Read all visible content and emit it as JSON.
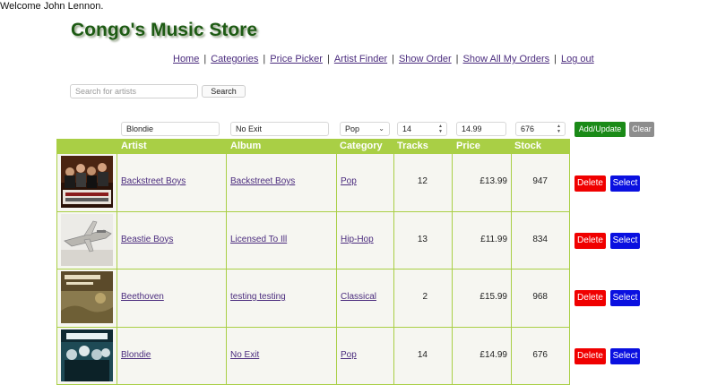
{
  "welcome": "Welcome John Lennon.",
  "title": "Congo's Music Store",
  "nav": [
    "Home",
    "Categories",
    "Price Picker",
    "Artist Finder",
    "Show Order",
    "Show All My Orders",
    "Log out"
  ],
  "search": {
    "placeholder": "Search for artists",
    "button": "Search"
  },
  "form": {
    "artist": "Blondie",
    "album": "No Exit",
    "category": "Pop",
    "tracks": "14",
    "price": "14.99",
    "stock": "676",
    "add_label": "Add/Update",
    "clear_label": "Clear"
  },
  "columns": [
    "Artist",
    "Album",
    "Category",
    "Tracks",
    "Price",
    "Stock"
  ],
  "rows": [
    {
      "artist": "Backstreet Boys",
      "album": "Backstreet Boys",
      "category": "Pop",
      "tracks": "12",
      "price": "£13.99",
      "stock": "947"
    },
    {
      "artist": "Beastie Boys",
      "album": "Licensed To Ill",
      "category": "Hip-Hop",
      "tracks": "13",
      "price": "£11.99",
      "stock": "834"
    },
    {
      "artist": "Beethoven",
      "album": "testing testing",
      "category": "Classical",
      "tracks": "2",
      "price": "£15.99",
      "stock": "968"
    },
    {
      "artist": "Blondie",
      "album": "No Exit",
      "category": "Pop",
      "tracks": "14",
      "price": "£14.99",
      "stock": "676"
    }
  ],
  "row_actions": {
    "delete": "Delete",
    "select": "Select"
  },
  "colors": {
    "title": "#1e5b14",
    "header_bg": "#a9cf45",
    "link": "#4b2c7e",
    "add": "#1a8a17",
    "delete": "#f00000",
    "select": "#0a10e0",
    "clear": "#8d8d8d"
  }
}
